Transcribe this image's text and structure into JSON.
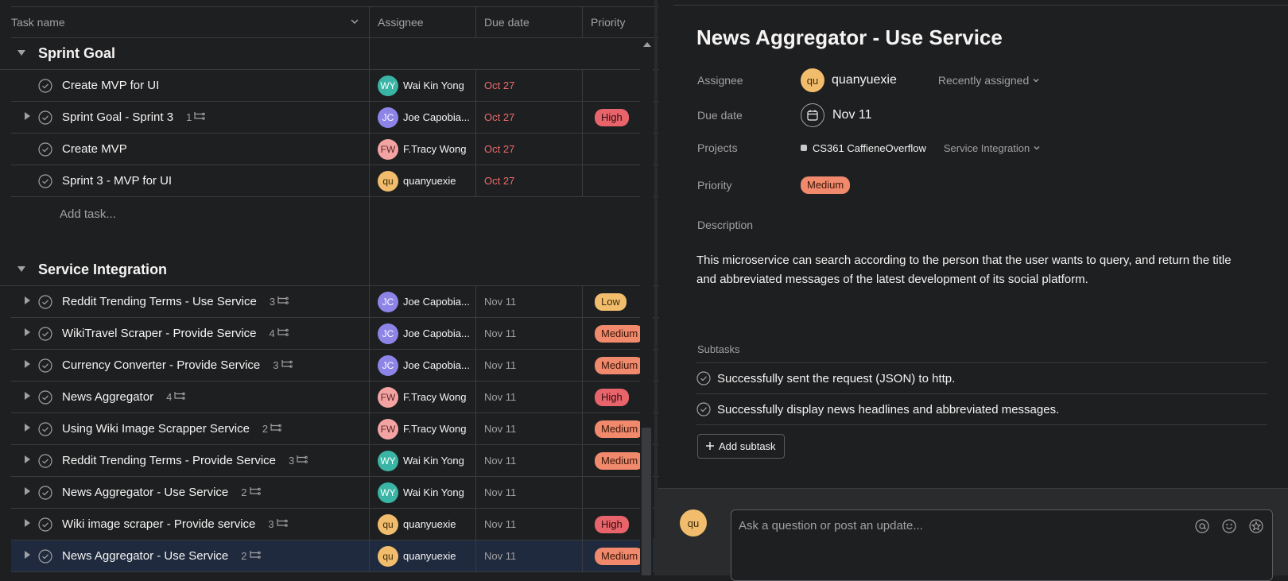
{
  "columns": {
    "task": "Task name",
    "assignee": "Assignee",
    "due": "Due date",
    "priority": "Priority"
  },
  "sections": [
    {
      "title": "Sprint Goal",
      "tasks": [
        {
          "name": "Create MVP for UI",
          "subtasks": "",
          "assignee_initials": "WY",
          "assignee": "Wai Kin Yong",
          "due": "Oct 27",
          "priority": ""
        },
        {
          "name": "Sprint Goal - Sprint 3",
          "subtasks": "1",
          "assignee_initials": "JC",
          "assignee": "Joe Capobia...",
          "due": "Oct 27",
          "priority": "High"
        },
        {
          "name": "Create MVP",
          "subtasks": "",
          "assignee_initials": "FW",
          "assignee": "F.Tracy Wong",
          "due": "Oct 27",
          "priority": ""
        },
        {
          "name": "Sprint 3 - MVP for UI",
          "subtasks": "",
          "assignee_initials": "qu",
          "assignee": "quanyuexie",
          "due": "Oct 27",
          "priority": ""
        }
      ],
      "add_task": "Add task..."
    },
    {
      "title": "Service Integration",
      "tasks": [
        {
          "name": "Reddit Trending Terms - Use Service",
          "subtasks": "3",
          "assignee_initials": "JC",
          "assignee": "Joe Capobia...",
          "due": "Nov 11",
          "priority": "Low"
        },
        {
          "name": "WikiTravel Scraper - Provide Service",
          "subtasks": "4",
          "assignee_initials": "JC",
          "assignee": "Joe Capobia...",
          "due": "Nov 11",
          "priority": "Medium"
        },
        {
          "name": "Currency Converter - Provide Service",
          "subtasks": "3",
          "assignee_initials": "JC",
          "assignee": "Joe Capobia...",
          "due": "Nov 11",
          "priority": "Medium"
        },
        {
          "name": "News Aggregator",
          "subtasks": "4",
          "assignee_initials": "FW",
          "assignee": "F.Tracy Wong",
          "due": "Nov 11",
          "priority": "High"
        },
        {
          "name": "Using Wiki Image Scrapper Service",
          "subtasks": "2",
          "assignee_initials": "FW",
          "assignee": "F.Tracy Wong",
          "due": "Nov 11",
          "priority": "Medium"
        },
        {
          "name": "Reddit Trending Terms - Provide Service",
          "subtasks": "3",
          "assignee_initials": "WY",
          "assignee": "Wai Kin Yong",
          "due": "Nov 11",
          "priority": "Medium"
        },
        {
          "name": "News Aggregator - Use Service",
          "subtasks": "2",
          "assignee_initials": "WY",
          "assignee": "Wai Kin Yong",
          "due": "Nov 11",
          "priority": ""
        },
        {
          "name": "Wiki image scraper - Provide service",
          "subtasks": "3",
          "assignee_initials": "qu",
          "assignee": "quanyuexie",
          "due": "Nov 11",
          "priority": "High"
        },
        {
          "name": "News Aggregator - Use Service",
          "subtasks": "2",
          "assignee_initials": "qu",
          "assignee": "quanyuexie",
          "due": "Nov 11",
          "priority": "Medium"
        }
      ]
    }
  ],
  "detail": {
    "title": "News Aggregator - Use Service",
    "assignee_label": "Assignee",
    "assignee_initials": "qu",
    "assignee_name": "quanyuexie",
    "recently_assigned": "Recently assigned",
    "due_label": "Due date",
    "due_value": "Nov 11",
    "projects_label": "Projects",
    "project_name": "CS361 CaffieneOverflow",
    "project_section": "Service Integration",
    "priority_label": "Priority",
    "priority_value": "Medium",
    "description_label": "Description",
    "description": "This microservice can search according to the person that the user wants to query, and return the title and abbreviated messages of the latest development of its social platform.",
    "subtasks_label": "Subtasks",
    "subtasks": [
      "Successfully sent the request (JSON) to http.",
      "Successfully display news headlines and abbreviated messages."
    ],
    "add_subtask": "Add subtask",
    "comment_avatar": "qu",
    "comment_placeholder": "Ask a question or post an update..."
  },
  "colors": {
    "accent_red": "#f06a6a",
    "selected_row": "#1f2a3e"
  }
}
